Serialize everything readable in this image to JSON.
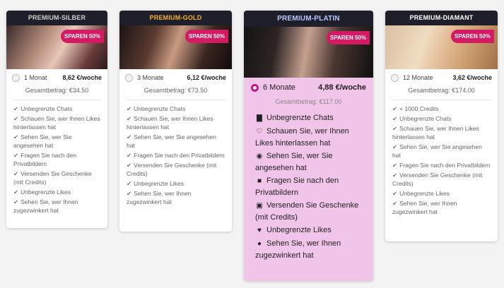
{
  "plans": [
    {
      "name": "PREMIUM-SILBER",
      "name_color": "#cfcfcf",
      "badge": "SPAREN 50%",
      "term": "1 Monat",
      "price": "8,62 €/woche",
      "total": "Gesamtbetrag: €34.50",
      "selected": false,
      "features": [
        "Unbegrenzte Chats",
        "Schauen Sie, wer Ihnen Likes hinterlassen hat",
        "Sehen Sie, wer Sie angesehen hat",
        "Fragen Sie nach den Privatbildern",
        "Versenden Sie Geschenke (mit Credits)",
        "Unbegrenzte Likes",
        "Sehen Sie, wer Ihnen zugezwinkert hat"
      ]
    },
    {
      "name": "PREMIUM-GOLD",
      "name_color": "#f0b224",
      "badge": "SPAREN 50%",
      "term": "3 Monate",
      "price": "6,12 €/woche",
      "total": "Gesamtbetrag: €73.50",
      "selected": false,
      "features": [
        "Unbegrenzte Chats",
        "Schauen Sie, wer Ihnen Likes hinterlassen hat",
        "Sehen Sie, wer Sie angesehen hat",
        "Fragen Sie nach den Privatbildern",
        "Versenden Sie Geschenke (mit Credits)",
        "Unbegrenzte Likes",
        "Sehen Sie, wer Ihnen zugezwinkert hat"
      ]
    },
    {
      "name": "PREMIUM-PLATIN",
      "name_color": "#b9c7ff",
      "badge": "SPAREN 50%",
      "term": "6 Monate",
      "price": "4,88 €/woche",
      "total": "Gesamtbetrag: €117.00",
      "selected": true,
      "features": [
        "Unbegrenzte Chats",
        "Schauen Sie, wer Ihnen Likes hinterlassen hat",
        "Sehen Sie, wer Sie angesehen hat",
        "Fragen Sie nach den Privatbildern",
        "Versenden Sie Geschenke (mit Credits)",
        "Unbegrenzte Likes",
        "Sehen Sie, wer Ihnen zugezwinkert hat"
      ],
      "feature_icons": [
        "chat-icon",
        "heart-icon",
        "eye-icon",
        "lock-icon",
        "gift-icon",
        "heart-filled-icon",
        "wink-icon"
      ]
    },
    {
      "name": "PREMIUM-DIAMANT",
      "name_color": "#ffffff",
      "badge": "SPAREN 50%",
      "term": "12 Monate",
      "price": "3,62 €/woche",
      "total": "Gesamtbetrag: €174.00",
      "selected": false,
      "features": [
        "+ 1000 Credits",
        "Unbegrenzte Chats",
        "Schauen Sie, wer Ihnen Likes hinterlassen hat",
        "Sehen Sie, wer Sie angesehen hat",
        "Fragen Sie nach den Privatbildern",
        "Versenden Sie Geschenke (mit Credits)",
        "Unbegrenzte Likes",
        "Sehen Sie, wer Ihnen zugezwinkert hat"
      ]
    }
  ]
}
